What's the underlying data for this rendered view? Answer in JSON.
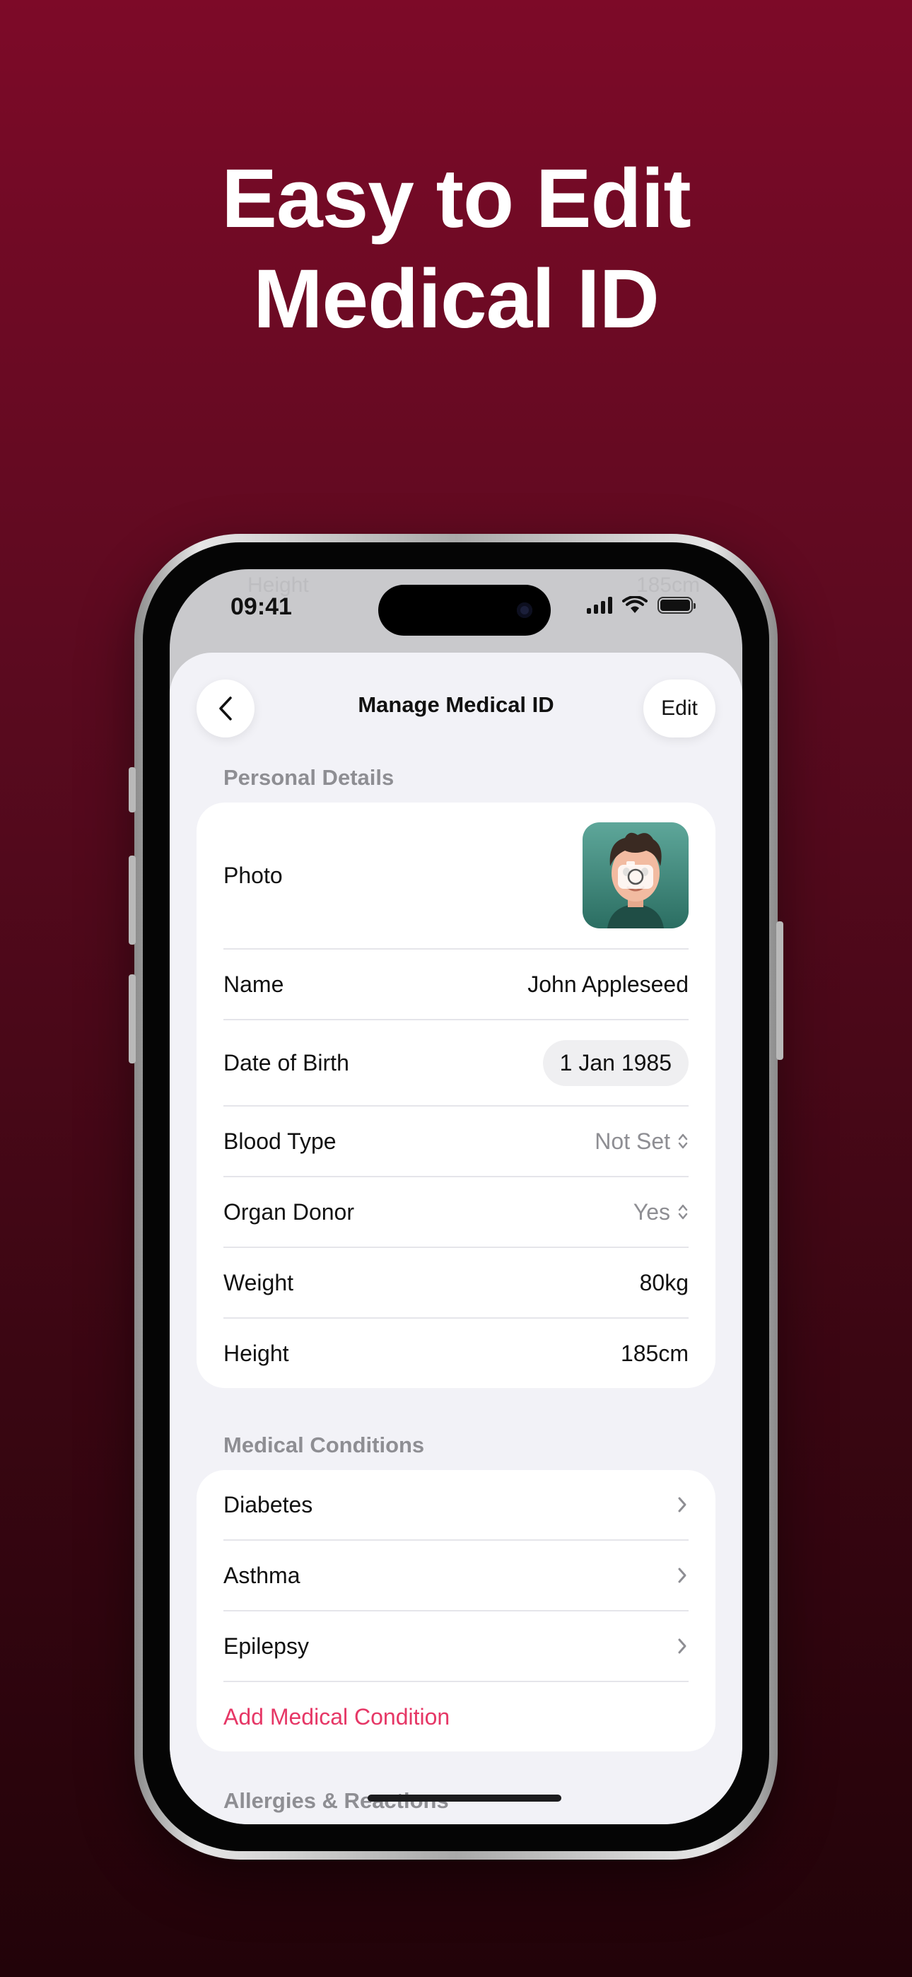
{
  "headline": {
    "line1": "Easy to Edit",
    "line2": "Medical ID"
  },
  "status_bar": {
    "time": "09:41",
    "ghost_left": "Height",
    "ghost_right": "185cm"
  },
  "nav": {
    "title": "Manage Medical ID",
    "edit_label": "Edit"
  },
  "personal": {
    "header": "Personal Details",
    "photo_label": "Photo",
    "rows": [
      {
        "label": "Name",
        "value": "John Appleseed"
      },
      {
        "label": "Date of Birth",
        "value": "1 Jan 1985"
      },
      {
        "label": "Blood Type",
        "value": "Not Set"
      },
      {
        "label": "Organ Donor",
        "value": "Yes"
      },
      {
        "label": "Weight",
        "value": "80kg"
      },
      {
        "label": "Height",
        "value": "185cm"
      }
    ]
  },
  "conditions": {
    "header": "Medical Conditions",
    "items": [
      "Diabetes",
      "Asthma",
      "Epilepsy"
    ],
    "add_label": "Add Medical Condition"
  },
  "allergies": {
    "header": "Allergies & Reactions"
  },
  "colors": {
    "accent": "#e63766",
    "background_top": "#7d0a28",
    "background_bottom": "#220309"
  }
}
